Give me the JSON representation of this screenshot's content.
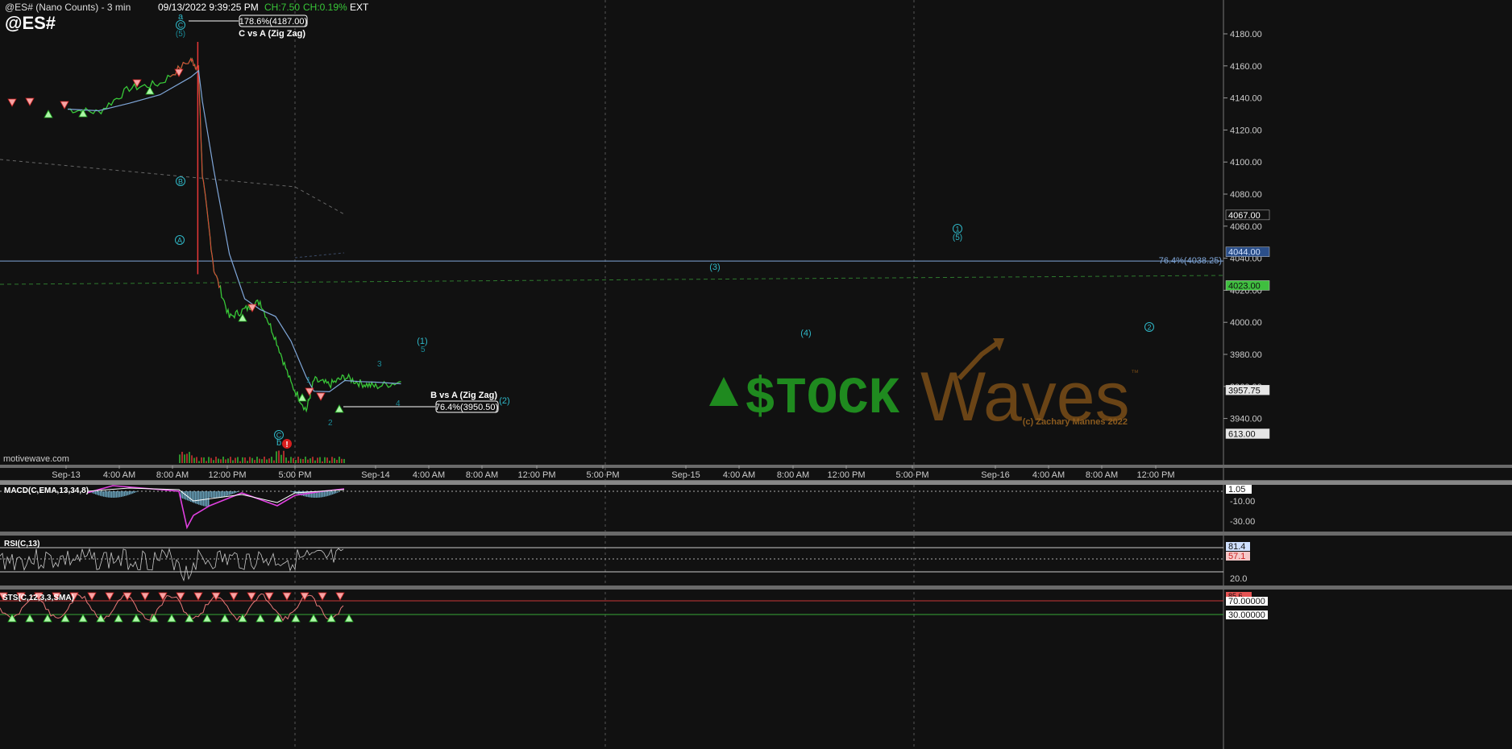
{
  "header": {
    "title": "@ES# (Nano Counts) - 3 min",
    "datetime": "09/13/2022 9:39:25 PM",
    "change": "CH:7.50",
    "change_pct": "CH:0.19%",
    "session": "EXT",
    "symbol": "@ES#"
  },
  "attribution": "motivewave.com",
  "watermark": {
    "left": "$TOCK",
    "right": "Waves",
    "tm": "™",
    "copyright": "(c) Zachary Mannes 2022"
  },
  "price_panel": {
    "y_ticks": [
      "4180.00",
      "4160.00",
      "4140.00",
      "4120.00",
      "4100.00",
      "4080.00",
      "4060.00",
      "4040.00",
      "4020.00",
      "4000.00",
      "3980.00",
      "3960.00",
      "3940.00"
    ],
    "y_range": [
      3930,
      4190
    ],
    "badges": {
      "b1": "4067.00",
      "b2": "4044.00",
      "b3": "4023.00",
      "b4": "3957.75",
      "b5": "613.00"
    },
    "fib_line_label": "76.4%(4038.25)",
    "fib_line_value": 4038.25,
    "annotations": {
      "c_vs_a_box": "178.6%(4187.00)",
      "c_vs_a_label": "C vs A (Zig Zag)",
      "b_vs_a_label": "B vs A (Zig Zag)",
      "b_vs_a_box": "76.4%(3950.50)"
    },
    "wave_labels": {
      "a_top": "a",
      "c_top": "C",
      "five_top": "(5)",
      "B_circ": "B",
      "A_circ": "A",
      "c_bottom": "C",
      "b_bottom": "b",
      "alert": "!",
      "w1": "1",
      "w2": "2",
      "w3": "3",
      "w4": "4",
      "w5": "5",
      "p1": "(1)",
      "p2": "(2)",
      "p3": "(3)",
      "p4": "(4)",
      "circ1": "1",
      "circ5": "(5)",
      "circ2": "2"
    }
  },
  "x_axis": [
    "Sep-13",
    "4:00 AM",
    "8:00 AM",
    "12:00 PM",
    "5:00 PM",
    "Sep-14",
    "4:00 AM",
    "8:00 AM",
    "12:00 PM",
    "5:00 PM",
    "Sep-15",
    "4:00 AM",
    "8:00 AM",
    "12:00 PM",
    "5:00 PM",
    "Sep-16",
    "4:00 AM",
    "8:00 AM",
    "12:00 PM"
  ],
  "macd_panel": {
    "label": "MACD(C,EMA,13,34,8)",
    "ticks": [
      "-10.00",
      "-30.00"
    ],
    "badge": "1.05"
  },
  "rsi_panel": {
    "label": "RSI(C,13)",
    "badge_a": "81.4",
    "badge_b": "57.1",
    "tick": "20.0"
  },
  "sts_panel": {
    "label": "STS(C,12,3,3,SMA)",
    "badge_top": "85.6",
    "badge_70": "70.00000",
    "badge_30": "30.00000"
  },
  "colors": {
    "background": "#111111",
    "up": "#38c738",
    "down": "#e83838",
    "ma": "#7fa6d8",
    "fib": "#7fa6d8",
    "wave": "#2fb8c8",
    "macd_line": "#e040e0",
    "macd_hist": "#7fc8e8",
    "watermark_green": "#1f8a1f",
    "watermark_brown": "#6a4416"
  },
  "chart_data": {
    "type": "line",
    "title": "@ES# (Nano Counts) - 3 min",
    "xlabel": "",
    "ylabel": "",
    "ylim": [
      3930,
      4190
    ],
    "series": [
      {
        "name": "",
        "x": [
          "Sep-13 00:00",
          "Sep-13 02:00",
          "Sep-13 04:00",
          "Sep-13 06:00",
          "Sep-13 08:00",
          "Sep-13 08:30",
          "Sep-13 08:45",
          "Sep-13 09:30",
          "Sep-13 10:30",
          "Sep-13 11:30",
          "Sep-13 12:30",
          "Sep-13 13:30",
          "Sep-13 14:30",
          "Sep-13 15:30",
          "Sep-13 16:00",
          "Sep-13 17:00",
          "Sep-13 18:00",
          "Sep-13 19:00",
          "Sep-13 20:00",
          "Sep-13 21:39"
        ],
        "values": [
          4133,
          4131,
          4146,
          4149,
          4164,
          4158,
          4092,
          4033,
          4003,
          4008,
          4013,
          3990,
          3962,
          3945,
          3964,
          3961,
          3966,
          3962,
          3960,
          3963
        ]
      }
    ]
  }
}
